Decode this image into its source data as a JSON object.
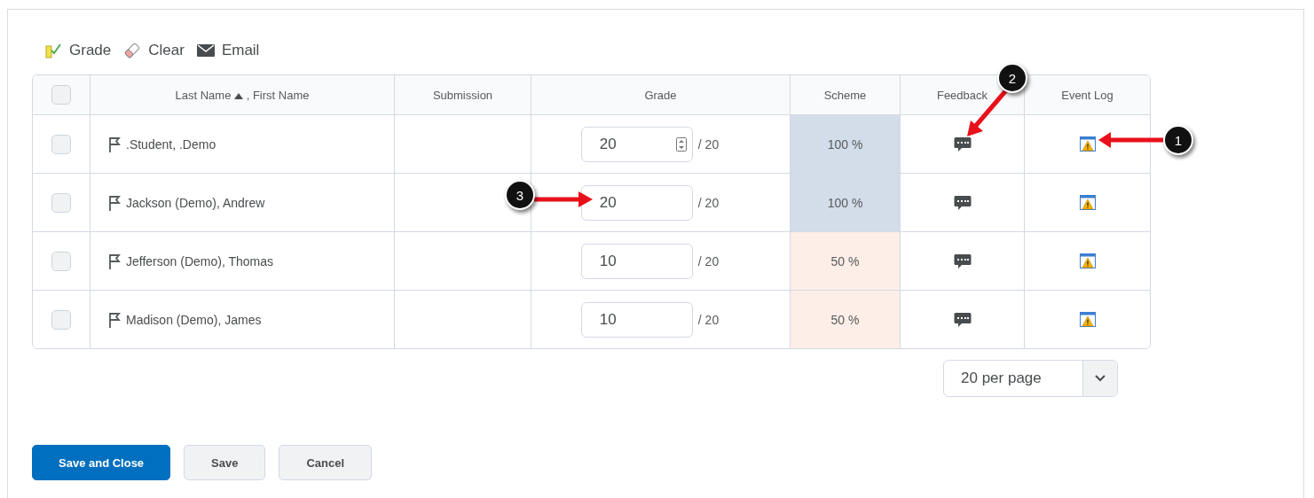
{
  "toolbar": [
    {
      "kind": "grade",
      "label": "Grade"
    },
    {
      "kind": "clear",
      "label": "Clear"
    },
    {
      "kind": "email",
      "label": "Email"
    }
  ],
  "table": {
    "select_all": {
      "checked": false
    },
    "columns": [
      {
        "kind": "select"
      },
      {
        "kind": "name",
        "label_before": "Last Name",
        "label_after": ", First Name",
        "sorted": true
      },
      {
        "kind": "text",
        "label": "Submission"
      },
      {
        "kind": "text",
        "label": "Grade"
      },
      {
        "kind": "text",
        "label": "Scheme"
      },
      {
        "kind": "text",
        "label": "Feedback"
      },
      {
        "kind": "text",
        "label": "Event Log"
      }
    ],
    "rows": [
      {
        "checked": false,
        "name": ".Student, .Demo",
        "grade": "20",
        "out_of": "/ 20",
        "spinner": true,
        "scheme": "100 %",
        "color": "#d3dce9"
      },
      {
        "checked": false,
        "name": "Jackson (Demo), Andrew",
        "grade": "20",
        "out_of": "/ 20",
        "spinner": false,
        "scheme": "100 %",
        "color": "#d3dce9"
      },
      {
        "checked": false,
        "name": "Jefferson (Demo), Thomas",
        "grade": "10",
        "out_of": "/ 20",
        "spinner": false,
        "scheme": "50 %",
        "color": "#fdeee8"
      },
      {
        "checked": false,
        "name": "Madison (Demo), James",
        "grade": "10",
        "out_of": "/ 20",
        "spinner": false,
        "scheme": "50 %",
        "color": "#fdeee8"
      }
    ]
  },
  "per_page": "20 per page",
  "buttons": [
    {
      "label": "Save and Close",
      "primary": true
    },
    {
      "label": "Save",
      "primary": false
    },
    {
      "label": "Cancel",
      "primary": false
    }
  ],
  "callouts": [
    {
      "number": "1"
    },
    {
      "number": "2"
    },
    {
      "number": "3"
    }
  ]
}
